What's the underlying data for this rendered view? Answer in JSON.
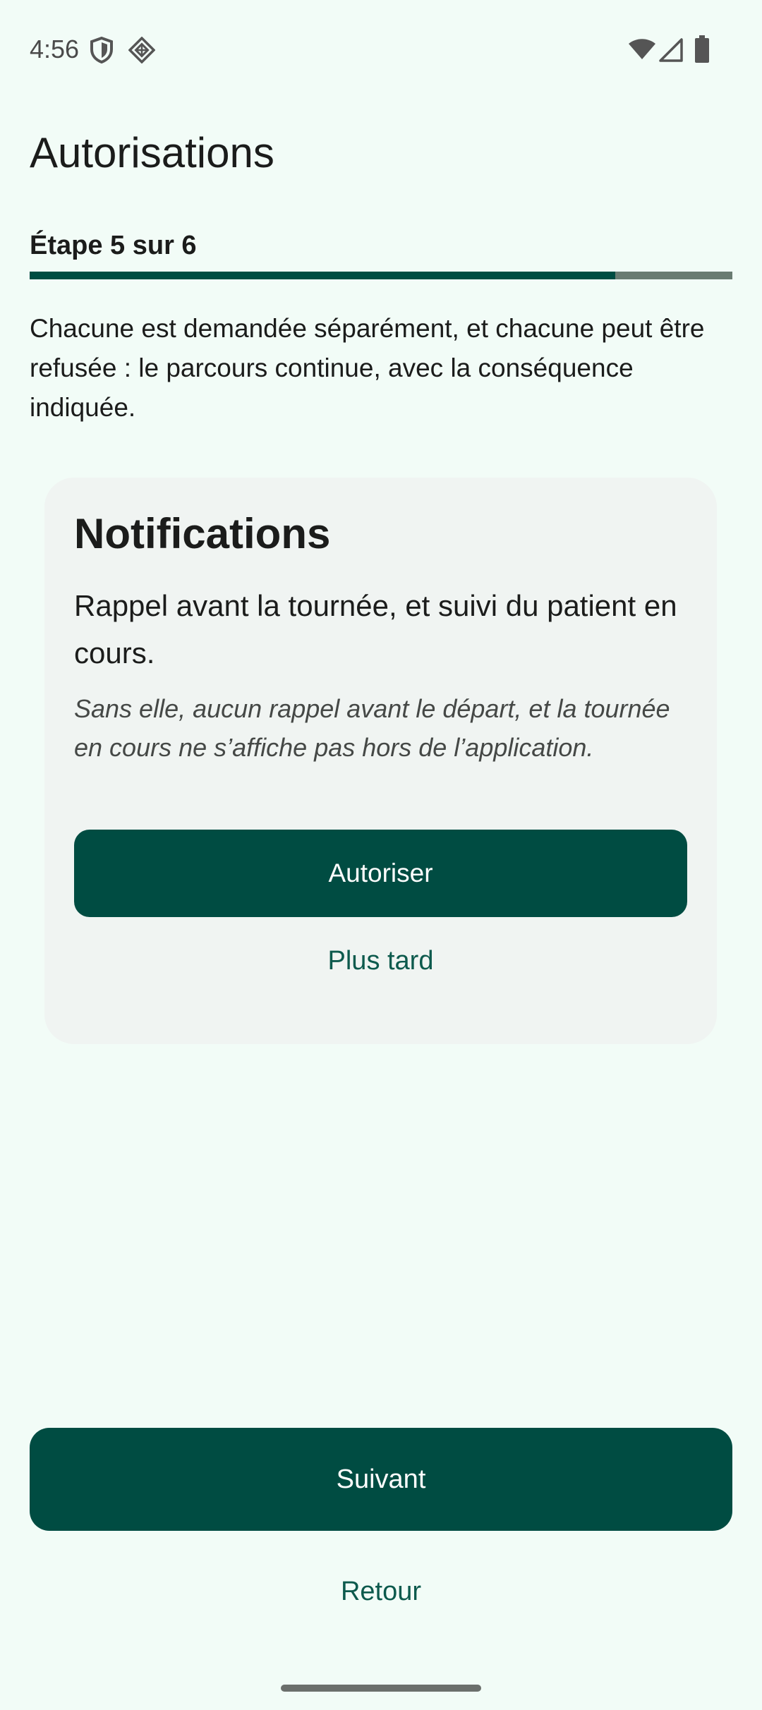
{
  "status_bar": {
    "time": "4:56",
    "icons": [
      "shield-icon",
      "vpn-key-icon",
      "wifi-icon",
      "signal-icon",
      "battery-icon"
    ]
  },
  "page": {
    "title": "Autorisations",
    "step_label": "Étape 5 sur 6",
    "progress": {
      "current": 5,
      "total": 6
    },
    "intro": "Chacune est demandée séparément, et chacune peut être refusée : le parcours continue, avec la conséquence indiquée."
  },
  "permission_card": {
    "title": "Notifications",
    "description": "Rappel avant la tournée, et suivi du patient en cours.",
    "consequence": "Sans elle, aucun rappel avant le départ, et la tournée en cours ne s’affiche pas hors de l’application.",
    "allow_label": "Autoriser",
    "later_label": "Plus tard"
  },
  "footer": {
    "next_label": "Suivant",
    "back_label": "Retour"
  },
  "colors": {
    "background": "#f2fcf7",
    "primary": "#004c42",
    "primary_text_link": "#0d5a4d",
    "progress_track": "#6a7b72",
    "card": "#f0f4f2"
  }
}
